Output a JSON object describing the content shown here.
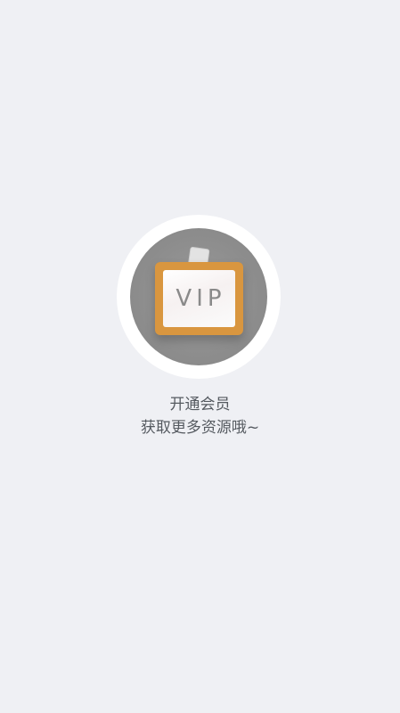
{
  "vip_prompt": {
    "badge_text": "VIP",
    "line1": "开通会员",
    "line2": "获取更多资源哦~"
  },
  "colors": {
    "background": "#eff0f4",
    "badge_frame": "#d9963f",
    "text": "#555a60"
  },
  "icons": {
    "vip_emblem": "vip-badge-icon"
  }
}
